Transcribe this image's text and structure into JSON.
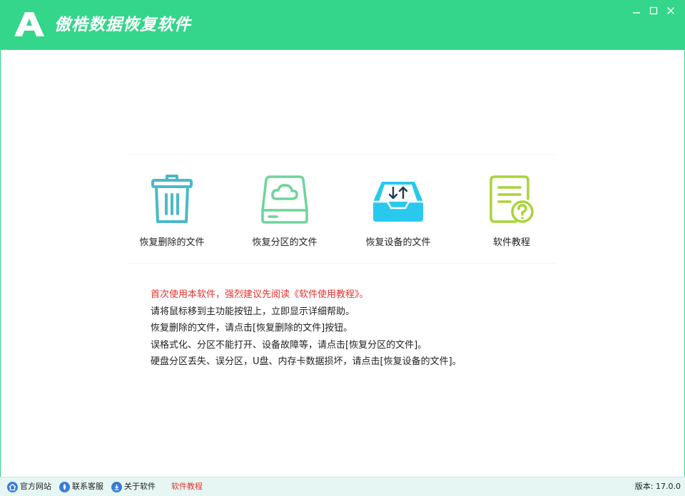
{
  "window": {
    "title": "傲梏数据恢复软件",
    "logo_letter": "A",
    "controls": [
      "minimize",
      "maximize",
      "close"
    ]
  },
  "colors": {
    "brand_green": "#33d68a",
    "trash_teal": "#4ab9c9",
    "partition_green": "#6fd49a",
    "device_blue": "#29c9ee",
    "tutorial_lime": "#a8d43a",
    "warning_red": "#e6322d",
    "status_bg": "#e5f6f3"
  },
  "features": [
    {
      "label": "恢复删除的文件",
      "icon": "trash-icon"
    },
    {
      "label": "恢复分区的文件",
      "icon": "cloud-drive-icon"
    },
    {
      "label": "恢复设备的文件",
      "icon": "device-tray-icon"
    },
    {
      "label": "软件教程",
      "icon": "document-help-icon"
    }
  ],
  "help": {
    "warning": "首次使用本软件，强烈建议先阅读《软件使用教程》。",
    "lines": [
      "请将鼠标移到主功能按钮上，立即显示详细帮助。",
      "恢复删除的文件，请点击[恢复删除的文件]按钮。",
      "误格式化、分区不能打开、设备故障等，请点击[恢复分区的文件]。",
      "硬盘分区丢失、误分区，U盘、内存卡数据损坏，请点击[恢复设备的文件]。"
    ]
  },
  "statusbar": {
    "links": [
      {
        "label": "官方网站",
        "icon": "home-icon"
      },
      {
        "label": "联系客服",
        "icon": "support-icon"
      },
      {
        "label": "关于软件",
        "icon": "info-icon"
      }
    ],
    "tutorial_link": "软件教程",
    "version": "版本: 17.0.0"
  }
}
